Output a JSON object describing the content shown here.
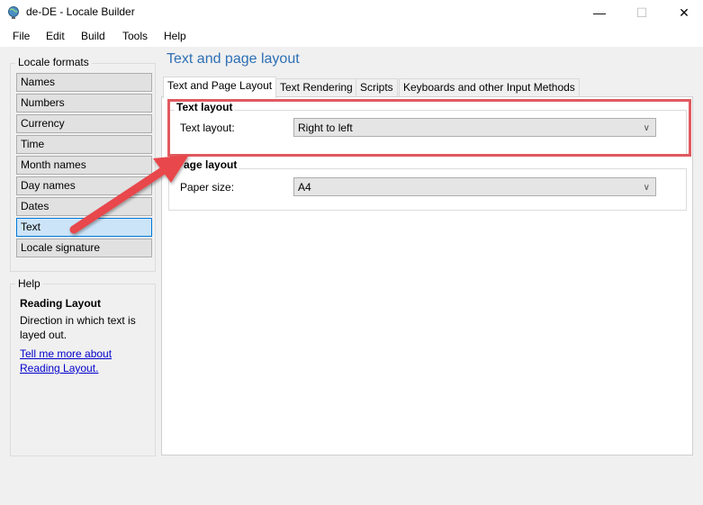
{
  "window": {
    "title": "de-DE - Locale Builder",
    "icon": "globe-app-icon",
    "controls": {
      "minimize": "—",
      "maximize": "☐",
      "close": "✕"
    }
  },
  "menu": [
    "File",
    "Edit",
    "Build",
    "Tools",
    "Help"
  ],
  "sidebar": {
    "group_label": "Locale formats",
    "items": [
      {
        "label": "Names",
        "active": false
      },
      {
        "label": "Numbers",
        "active": false
      },
      {
        "label": "Currency",
        "active": false
      },
      {
        "label": "Time",
        "active": false
      },
      {
        "label": "Month names",
        "active": false
      },
      {
        "label": "Day names",
        "active": false
      },
      {
        "label": "Dates",
        "active": false
      },
      {
        "label": "Text",
        "active": true
      },
      {
        "label": "Locale signature",
        "active": false
      }
    ]
  },
  "help": {
    "group_label": "Help",
    "title": "Reading Layout",
    "text": "Direction in which text is layed out.",
    "link": "Tell me more about Reading Layout."
  },
  "main": {
    "heading": "Text and page layout",
    "tabs": [
      {
        "label": "Text and Page Layout",
        "active": true
      },
      {
        "label": "Text Rendering",
        "active": false
      },
      {
        "label": "Scripts",
        "active": false
      },
      {
        "label": "Keyboards and other Input Methods",
        "active": false
      }
    ],
    "text_layout": {
      "legend": "Text layout",
      "label": "Text layout:",
      "value": "Right to left"
    },
    "page_layout": {
      "legend": "Page layout",
      "label": "Paper size:",
      "value": "A4"
    }
  },
  "annotation": {
    "highlight_color": "#e05a5f",
    "arrow_color": "#e8474c"
  }
}
